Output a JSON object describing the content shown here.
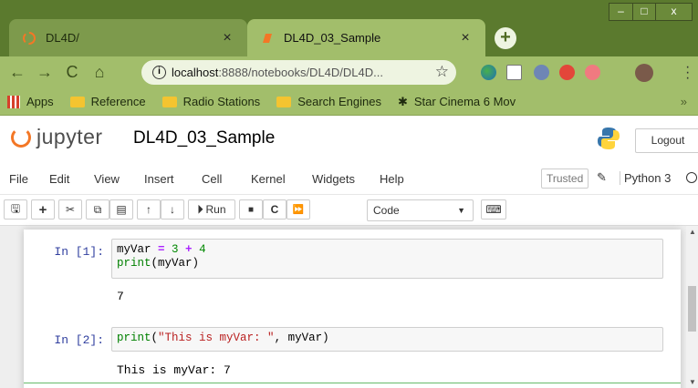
{
  "browser": {
    "tabs": [
      {
        "title": "DL4D/",
        "active": false
      },
      {
        "title": "DL4D_03_Sample",
        "active": true
      }
    ],
    "new_tab_label": "+",
    "window_controls": {
      "minimize": "–",
      "maximize": "□",
      "close": "x"
    },
    "url_host": "localhost",
    "url_path": ":8888/notebooks/DL4D/DL4D...",
    "star": "☆",
    "bookmarks": [
      {
        "label": "Apps",
        "icon": "apps-grid-icon"
      },
      {
        "label": "Reference",
        "icon": "folder-icon"
      },
      {
        "label": "Radio Stations",
        "icon": "folder-icon"
      },
      {
        "label": "Search Engines",
        "icon": "folder-icon"
      },
      {
        "label": "Star Cinema 6 Mov",
        "icon": "film-reel-icon"
      }
    ],
    "bookmarks_overflow": "»"
  },
  "jupyter": {
    "logo_text": "jupyter",
    "notebook_name": "DL4D_03_Sample",
    "logout_label": "Logout",
    "menu": [
      "File",
      "Edit",
      "View",
      "Insert",
      "Cell",
      "Kernel",
      "Widgets",
      "Help"
    ],
    "trusted_label": "Trusted",
    "kernel_name": "Python 3",
    "toolbar": {
      "run_label": "Run",
      "cell_type": "Code"
    }
  },
  "cells": [
    {
      "prompt": "In [1]:",
      "code_line1": {
        "a": "myVar",
        "b": " = ",
        "c": "3",
        "d": " + ",
        "e": "4"
      },
      "code_line2": {
        "fn": "print",
        "rest": "(myVar)"
      },
      "output": "7"
    },
    {
      "prompt": "In [2]:",
      "code": {
        "fn": "print",
        "open": "(",
        "str": "\"This is myVar: \"",
        "rest": ", myVar)"
      },
      "output": "This is myVar:  7"
    }
  ],
  "colors": {
    "chrome_frame": "#5b7a2e",
    "chrome_active": "#a2be6b",
    "jupyter_orange": "#f37726",
    "prompt_blue": "#303f9f"
  }
}
